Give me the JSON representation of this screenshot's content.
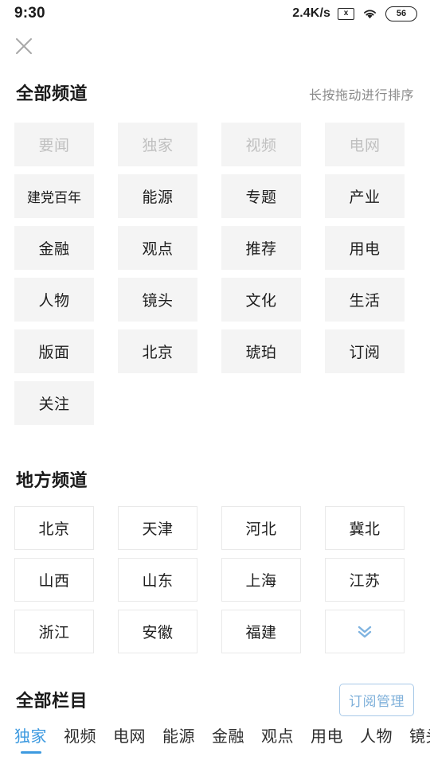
{
  "status_bar": {
    "time": "9:30",
    "network_speed": "2.4K/s",
    "sim_icon": "sim-no-card-icon",
    "sim_glyph": "x",
    "wifi_icon": "wifi-icon",
    "battery_level": "56"
  },
  "header": {
    "close_icon": "close-icon"
  },
  "all_channels": {
    "title": "全部频道",
    "hint": "长按拖动进行排序",
    "chips": [
      {
        "label": "要闻",
        "disabled": true
      },
      {
        "label": "独家",
        "disabled": true
      },
      {
        "label": "视频",
        "disabled": true
      },
      {
        "label": "电网",
        "disabled": true
      },
      {
        "label": "建党百年",
        "disabled": false
      },
      {
        "label": "能源",
        "disabled": false
      },
      {
        "label": "专题",
        "disabled": false
      },
      {
        "label": "产业",
        "disabled": false
      },
      {
        "label": "金融",
        "disabled": false
      },
      {
        "label": "观点",
        "disabled": false
      },
      {
        "label": "推荐",
        "disabled": false
      },
      {
        "label": "用电",
        "disabled": false
      },
      {
        "label": "人物",
        "disabled": false
      },
      {
        "label": "镜头",
        "disabled": false
      },
      {
        "label": "文化",
        "disabled": false
      },
      {
        "label": "生活",
        "disabled": false
      },
      {
        "label": "版面",
        "disabled": false
      },
      {
        "label": "北京",
        "disabled": false
      },
      {
        "label": "琥珀",
        "disabled": false
      },
      {
        "label": "订阅",
        "disabled": false
      },
      {
        "label": "关注",
        "disabled": false
      }
    ]
  },
  "local_channels": {
    "title": "地方频道",
    "chips": [
      {
        "label": "北京",
        "icon": null
      },
      {
        "label": "天津",
        "icon": null
      },
      {
        "label": "河北",
        "icon": null
      },
      {
        "label": "冀北",
        "icon": null
      },
      {
        "label": "山西",
        "icon": null
      },
      {
        "label": "山东",
        "icon": null
      },
      {
        "label": "上海",
        "icon": null
      },
      {
        "label": "江苏",
        "icon": null
      },
      {
        "label": "浙江",
        "icon": null
      },
      {
        "label": "安徽",
        "icon": null
      },
      {
        "label": "福建",
        "icon": null
      },
      {
        "label": "",
        "icon": "chevron-double-down-icon"
      }
    ]
  },
  "all_columns": {
    "title": "全部栏目",
    "manage_button": "订阅管理",
    "tabs": [
      {
        "label": "独家",
        "active": true
      },
      {
        "label": "视频",
        "active": false
      },
      {
        "label": "电网",
        "active": false
      },
      {
        "label": "能源",
        "active": false
      },
      {
        "label": "金融",
        "active": false
      },
      {
        "label": "观点",
        "active": false
      },
      {
        "label": "用电",
        "active": false
      },
      {
        "label": "人物",
        "active": false
      },
      {
        "label": "镜头",
        "active": false
      }
    ]
  },
  "colors": {
    "accent": "#3d9ae0",
    "accent_light": "#7fb3e0",
    "chip_bg": "#f4f4f4",
    "chip_border": "#e9e9e9",
    "text": "#1d1d1d",
    "muted": "#8a8a8a",
    "disabled": "#c0c0c0"
  }
}
